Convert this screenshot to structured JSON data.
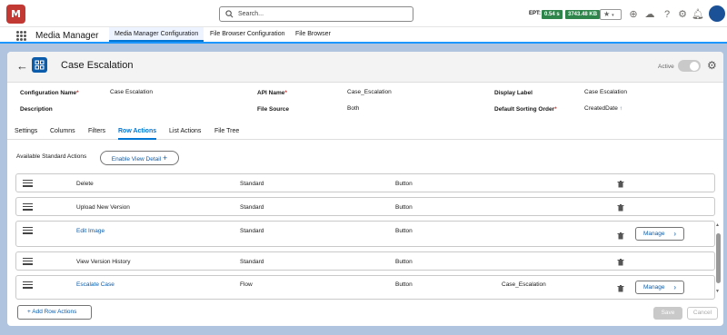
{
  "topbar": {
    "logo_text": "M",
    "search_placeholder": "Search...",
    "ept_label": "EPT:",
    "ept_value": "0.54 s",
    "memory_value": "3743.48 KB",
    "badge_color": "#2e844a"
  },
  "appbar": {
    "app_name": "Media Manager",
    "tabs": [
      "Media Manager Configuration",
      "File Browser Configuration",
      "File Browser"
    ]
  },
  "record": {
    "title": "Case Escalation",
    "active_label": "Active"
  },
  "fields": {
    "configuration_name_label": "Configuration Name",
    "configuration_name_value": "Case Escalation",
    "api_name_label": "API Name",
    "api_name_value": "Case_Escalation",
    "display_label_label": "Display Label",
    "display_label_value": "Case Escalation",
    "description_label": "Description",
    "file_source_label": "File Source",
    "file_source_value": "Both",
    "default_sorting_label": "Default Sorting Order",
    "default_sorting_value": "CreatedDate",
    "required_mark": "*"
  },
  "tabs": [
    "Settings",
    "Columns",
    "Filters",
    "Row Actions",
    "List Actions",
    "File Tree"
  ],
  "row_actions": {
    "available_label": "Available Standard Actions",
    "enable_view_detail": "Enable View Detail",
    "plus": "+",
    "manage_label": "Manage",
    "rows": [
      {
        "name": "Delete",
        "type": "Standard",
        "display": "Button",
        "extra": ""
      },
      {
        "name": "Upload New Version",
        "type": "Standard",
        "display": "Button",
        "extra": ""
      },
      {
        "name": "Edit Image",
        "type": "Standard",
        "display": "Button",
        "extra": ""
      },
      {
        "name": "View Version History",
        "type": "Standard",
        "display": "Button",
        "extra": ""
      },
      {
        "name": "Escalate Case",
        "type": "Flow",
        "display": "Button",
        "extra": "Case_Escalation"
      }
    ]
  },
  "footer": {
    "add_row_actions": "+ Add Row Actions",
    "save": "Save",
    "cancel": "Cancel"
  },
  "colors": {
    "accent": "#0176d3",
    "link": "#0b5cab",
    "logo": "#c23934",
    "background": "#b0c4df"
  }
}
